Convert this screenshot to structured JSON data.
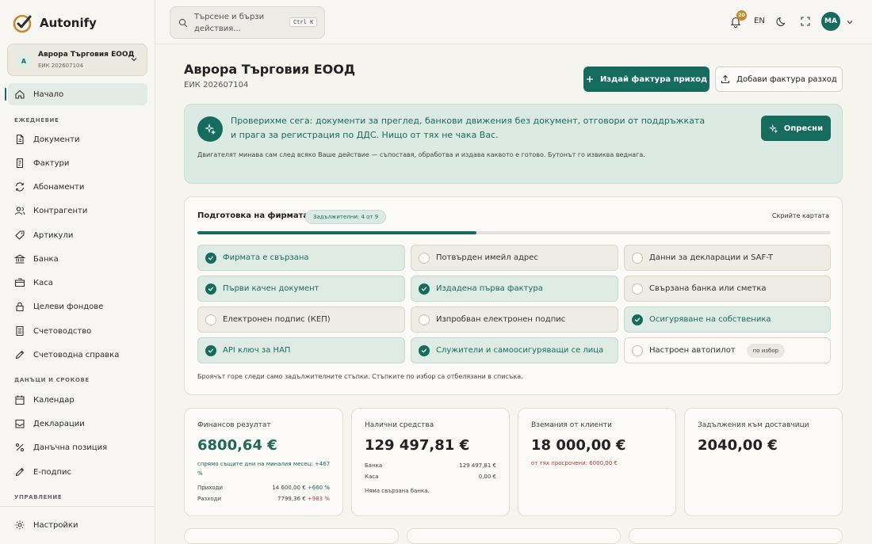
{
  "brand": {
    "name": "Autonify"
  },
  "company": {
    "avatar": "A",
    "name": "Аврора Търговия ЕООД",
    "eik": "ЕИК 202607104"
  },
  "nav": {
    "home": "Начало",
    "section_daily": "ЕЖЕДНЕВИЕ",
    "daily": [
      "Документи",
      "Фактури",
      "Абонаменти",
      "Контрагенти",
      "Артикули",
      "Банка",
      "Каса",
      "Целеви фондове",
      "Счетоводство",
      "Счетоводна справка"
    ],
    "section_taxes": "ДАНЪЦИ И СРОКОВЕ",
    "taxes": [
      "Календар",
      "Декларации",
      "Данъчна позиция",
      "Е-подпис"
    ],
    "section_manage": "УПРАВЛЕНИЕ",
    "settings": "Настройки"
  },
  "topbar": {
    "search_placeholder": "Търсене и бързи действия...",
    "shortcut": "Ctrl K",
    "notifications": "20",
    "lang": "EN",
    "user_initials": "МА"
  },
  "header": {
    "title": "Аврора Търговия ЕООД",
    "subtitle": "ЕИК 202607104",
    "issue_invoice": "Издай фактура приход",
    "add_expense": "Добави фактура разход"
  },
  "banner": {
    "message": "Проверихме сега: документи за преглед, банкови движения без документ, отговори от поддръжката и прага за регистрация по ДДС. Нищо от тях не чака Вас.",
    "note": "Двигателят минава сам след всяко Ваше действие — съпоставя, обработва и издава каквото е готово. Бутонът го извиква веднага.",
    "refresh": "Опресни"
  },
  "setup": {
    "title": "Подготовка на фирмата",
    "required_chip": "Задължителни: 4 от 9",
    "progress": 0.44,
    "hide": "Скрийте картата",
    "tiles": [
      {
        "label": "Фирмата е свързана",
        "done": true
      },
      {
        "label": "Потвърден имейл адрес",
        "done": false
      },
      {
        "label": "Данни за декларации и SAF-T",
        "done": false
      },
      {
        "label": "Първи качен документ",
        "done": true
      },
      {
        "label": "Издадена първа фактура",
        "done": true
      },
      {
        "label": "Свързана банка или сметка",
        "done": false
      },
      {
        "label": "Електронен подпис (КЕП)",
        "done": false
      },
      {
        "label": "Изпробван електронен подпис",
        "done": false
      },
      {
        "label": "Осигуряване на собственика",
        "done": true
      },
      {
        "label": "API ключ за НАП",
        "done": true
      },
      {
        "label": "Служители и самоосигуряващи се лица",
        "done": true
      },
      {
        "label": "Настроен автопилот",
        "done": false,
        "optional": "по избор"
      }
    ],
    "footer": "Броячът горе следи само задължителните стъпки. Стъпките по избор са отбелязани в списъка."
  },
  "stats": {
    "finance": {
      "label": "Финансов резултат",
      "value": "6800,64 €",
      "compare": "спрямо същите дни на миналия месец: +467 %",
      "income_label": "Приходи",
      "income_value": "14 600,00 €",
      "income_change": "+660 %",
      "expense_label": "Разходи",
      "expense_value": "7799,36 €",
      "expense_change": "+983 %"
    },
    "cash": {
      "label": "Налични средства",
      "value": "129 497,81 €",
      "bank_label": "Банка",
      "bank_value": "129 497,81 €",
      "cash_label": "Каса",
      "cash_value": "0,00 €",
      "note": "Няма свързана банка."
    },
    "receivables": {
      "label": "Вземания от клиенти",
      "value": "18 000,00 €",
      "overdue": "от тях просрочени: 6000,00 €"
    },
    "payables": {
      "label": "Задължения към доставчици",
      "value": "2040,00 €"
    }
  },
  "colors": {
    "accent": "#156b5e",
    "banner_bg": "#dceae4",
    "negative": "#b23a3a",
    "badge": "#c7892b"
  }
}
